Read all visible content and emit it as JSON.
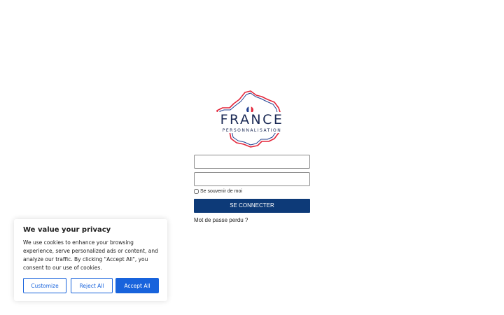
{
  "brand": {
    "name": "FRANCE",
    "subtitle": "PERSONNALISATION",
    "colors": {
      "navy": "#1b2a55",
      "red": "#e3263a",
      "blue": "#1f3f8f"
    }
  },
  "login_form": {
    "username_value": "",
    "password_value": "",
    "remember_label": "Se souvenir de moi",
    "remember_checked": false,
    "submit_label": "SE CONNECTER",
    "lost_password_label": "Mot de passe perdu ?",
    "accent_color": "#0d3a78"
  },
  "cookie_banner": {
    "title": "We value your privacy",
    "text": "We use cookies to enhance your browsing experience, serve personalized ads or content, and analyze our traffic. By clicking \"Accept All\", you consent to our use of cookies.",
    "customize_label": "Customize",
    "reject_label": "Reject All",
    "accept_label": "Accept All",
    "accent_color": "#1863dc"
  }
}
